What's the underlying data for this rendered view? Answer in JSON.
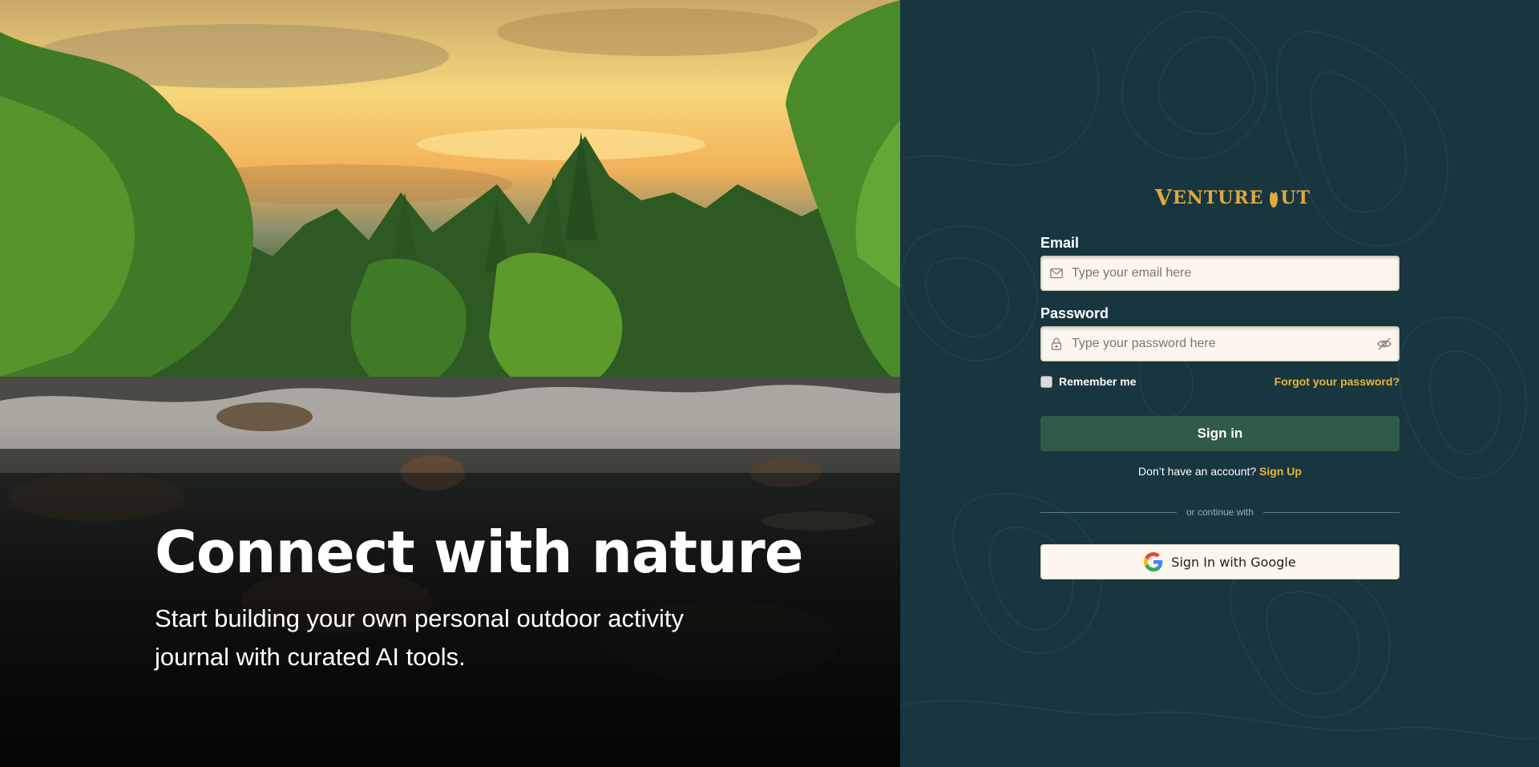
{
  "hero": {
    "title": "Connect with nature",
    "subtitle": "Start building your own personal outdoor activity journal with curated AI tools."
  },
  "brand": {
    "logo_text": "Venture Out",
    "accent_color": "#e0a93b",
    "panel_color": "#17363f",
    "button_color": "#2f5b48"
  },
  "form": {
    "email": {
      "label": "Email",
      "placeholder": "Type your email here",
      "value": "",
      "icon": "mail-icon"
    },
    "password": {
      "label": "Password",
      "placeholder": "Type your password here",
      "value": "",
      "icon": "lock-icon",
      "toggle_icon": "eye-off-icon"
    },
    "remember_label": "Remember me",
    "remember_checked": false,
    "forgot_label": "Forgot your password?",
    "submit_label": "Sign in",
    "signup_prompt": "Don’t have an account?",
    "signup_link": "Sign Up",
    "divider_text": "or continue with",
    "google_label": "Sign In with Google"
  }
}
